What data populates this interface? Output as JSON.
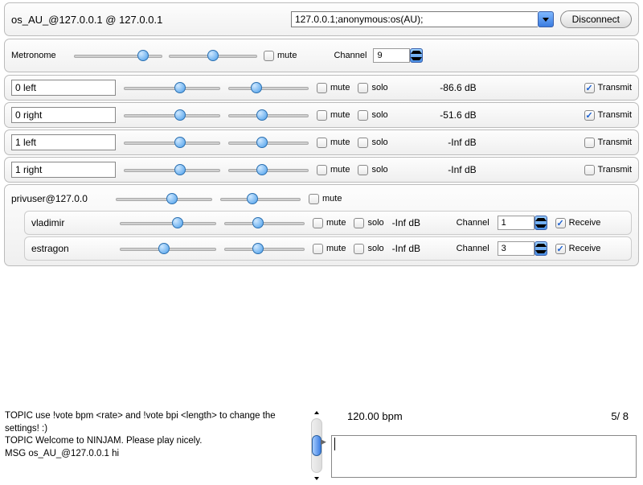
{
  "header": {
    "title": "os_AU_@127.0.0.1 @ 127.0.0.1",
    "server_string": "127.0.0.1;anonymous:os(AU);",
    "disconnect": "Disconnect"
  },
  "metronome": {
    "label": "Metronome",
    "mute": "mute",
    "channel_label": "Channel",
    "channel": "9"
  },
  "local_channels": [
    {
      "name": "0 left",
      "db": "-86.6 dB",
      "transmit": true,
      "s1": 58,
      "s2": 35
    },
    {
      "name": "0 right",
      "db": "-51.6 dB",
      "transmit": true,
      "s1": 58,
      "s2": 42
    },
    {
      "name": "1 left",
      "db": "-Inf dB",
      "transmit": false,
      "s1": 58,
      "s2": 42
    },
    {
      "name": "1 right",
      "db": "-Inf dB",
      "transmit": false,
      "s1": 58,
      "s2": 42
    }
  ],
  "labels": {
    "mute": "mute",
    "solo": "solo",
    "transmit": "Transmit",
    "receive": "Receive",
    "channel": "Channel"
  },
  "remote": {
    "user": "privuser@127.0.0",
    "header_s1": 58,
    "header_s2": 40,
    "subs": [
      {
        "name": "vladimir",
        "db": "-Inf dB",
        "channel": "1",
        "receive": true,
        "s1": 60,
        "s2": 42
      },
      {
        "name": "estragon",
        "db": "-Inf dB",
        "channel": "3",
        "receive": true,
        "s1": 46,
        "s2": 42
      }
    ]
  },
  "chat": {
    "line1": "TOPIC  use !vote bpm <rate> and !vote bpi <length> to change the settings! :)",
    "line2": "TOPIC  Welcome to NINJAM. Please play nicely.",
    "line3": "MSG os_AU_@127.0.0.1 hi"
  },
  "tempo": {
    "bpm": "120.00 bpm",
    "sig": "5/ 8"
  }
}
